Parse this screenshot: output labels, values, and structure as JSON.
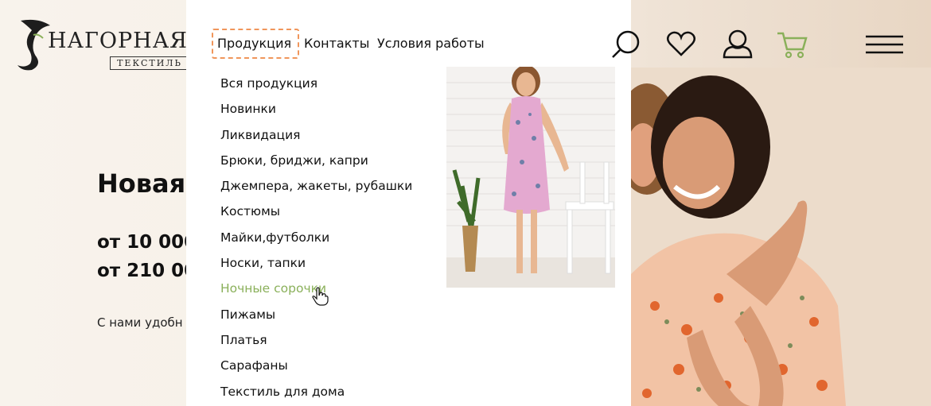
{
  "logo": {
    "name": "НАГОРНАЯ",
    "sub": "ТЕКСТИЛЬ"
  },
  "nav": {
    "products": "Продукция",
    "contacts": "Контакты",
    "terms": "Условия работы"
  },
  "categories": [
    "Вся продукция",
    "Новинки",
    "Ликвидация",
    "Брюки, бриджи, капри",
    "Джемпера, жакеты, рубашки",
    "Костюмы",
    "Майки,футболки",
    "Носки, тапки",
    "Ночные сорочки",
    "Пижамы",
    "Платья",
    "Сарафаны",
    "Текстиль для дома"
  ],
  "active_category_index": 8,
  "hero": {
    "title": "Новая",
    "line1": "от 10 000",
    "line2": "от 210 00",
    "small": "С нами удобн"
  },
  "icons": [
    "search-icon",
    "heart-icon",
    "user-icon",
    "cart-icon",
    "hamburger-menu-icon"
  ],
  "colors": {
    "accent_green": "#8ab05a",
    "focus_orange": "#f0965b"
  }
}
